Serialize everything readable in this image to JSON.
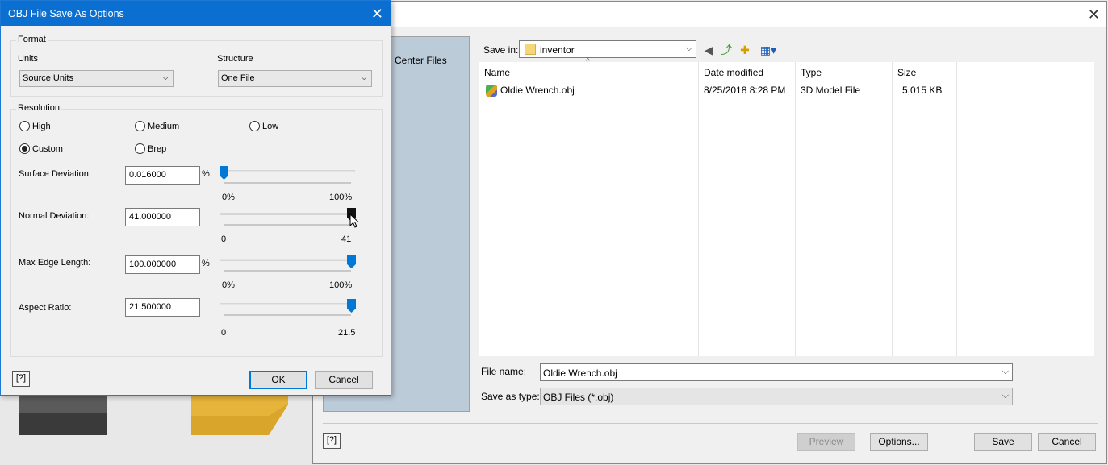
{
  "save_dialog": {
    "places_label": "Center Files",
    "save_in_label": "Save in:",
    "save_in_value": "inventor",
    "columns": [
      "Name",
      "Date modified",
      "Type",
      "Size"
    ],
    "files": [
      {
        "name": "Oldie Wrench.obj",
        "date": "8/25/2018 8:28 PM",
        "type": "3D Model File",
        "size": "5,015 KB"
      }
    ],
    "file_name_label": "File name:",
    "file_name_value": "Oldie Wrench.obj",
    "save_type_label": "Save as type:",
    "save_type_value": "OBJ Files (*.obj)",
    "preview_label": "Preview",
    "options_label": "Options...",
    "save_label": "Save",
    "cancel_label": "Cancel"
  },
  "obj_dialog": {
    "title": "OBJ File Save As Options",
    "format_group": "Format",
    "units_label": "Units",
    "units_value": "Source Units",
    "structure_label": "Structure",
    "structure_value": "One File",
    "resolution_group": "Resolution",
    "radio_high": "High",
    "radio_medium": "Medium",
    "radio_low": "Low",
    "radio_custom": "Custom",
    "radio_brep": "Brep",
    "surface_label": "Surface Deviation:",
    "surface_value": "0.016000",
    "surface_unit": "%",
    "surface_min": "0%",
    "surface_max": "100%",
    "normal_label": "Normal Deviation:",
    "normal_value": "41.000000",
    "normal_min": "0",
    "normal_max": "41",
    "edge_label": "Max Edge Length:",
    "edge_value": "100.000000",
    "edge_unit": "%",
    "edge_min": "0%",
    "edge_max": "100%",
    "aspect_label": "Aspect Ratio:",
    "aspect_value": "21.500000",
    "aspect_min": "0",
    "aspect_max": "21.5",
    "ok_label": "OK",
    "cancel_label": "Cancel",
    "help_label": "?"
  },
  "sliders": {
    "surface_fraction": 0.0,
    "normal_fraction": 1.0,
    "edge_fraction": 1.0,
    "aspect_fraction": 1.0
  },
  "colors": {
    "title_bar": "#0a6fd0",
    "slider_thumb": "#0078d7"
  }
}
